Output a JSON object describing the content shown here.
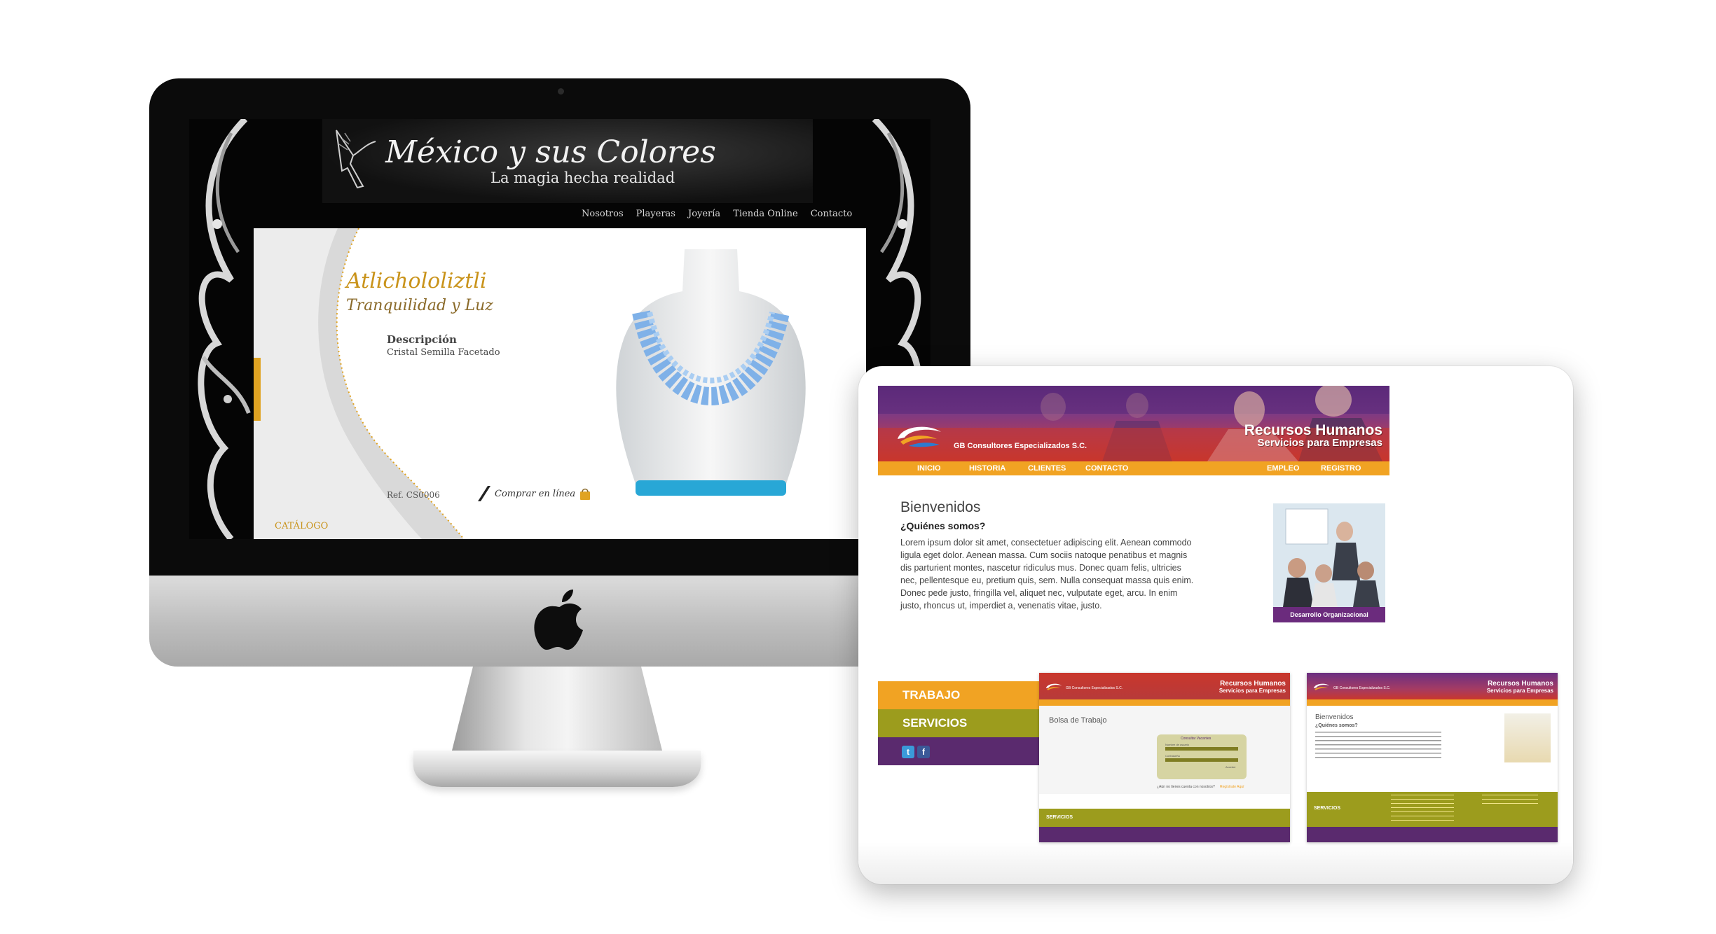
{
  "imac_site": {
    "title": "México y sus Colores",
    "tagline": "La magia hecha realidad",
    "nav": [
      "Nosotros",
      "Playeras",
      "Joyería",
      "Tienda Online",
      "Contacto"
    ],
    "product": {
      "name": "Atlichololiztli",
      "subtitle": "Tranquilidad y Luz",
      "description_label": "Descripción",
      "description": "Cristal Semilla Facetado",
      "ref": "Ref. CS0006",
      "buy_label": "Comprar en línea"
    },
    "catalog_label": "CATÁLOGO"
  },
  "tablet_site": {
    "company": "GB Consultores Especializados S.C.",
    "hero_title": "Recursos Humanos",
    "hero_subtitle": "Servicios para Empresas",
    "nav_left": [
      "INICIO",
      "HISTORIA",
      "CLIENTES",
      "CONTACTO"
    ],
    "nav_right": [
      "EMPLEO",
      "REGISTRO"
    ],
    "welcome": "Bienvenidos",
    "who_heading": "¿Quiénes somos?",
    "body": "Lorem ipsum dolor sit amet, consectetuer adipiscing elit. Aenean commodo ligula eget dolor. Aenean massa. Cum sociis natoque penatibus et magnis dis parturient montes, nascetur ridiculus mus. Donec quam felis, ultricies nec, pellentesque eu, pretium quis, sem. Nulla consequat massa quis enim. Donec pede justo, fringilla vel, aliquet nec, vulputate eget, arcu. In enim justo, rhoncus ut, imperdiet a, venenatis vitae, justo.",
    "photo_caption": "Desarrollo Organizacional",
    "sidebar": [
      "TRABAJO",
      "SERVICIOS"
    ],
    "social": [
      "twitter-icon",
      "facebook-icon"
    ],
    "mini_1": {
      "heading": "Bolsa de Trabajo",
      "form_title": "Consultar Vacantes",
      "field_1": "Nombre de usuario",
      "field_2": "Contraseña",
      "submit": "Acceder",
      "register_prompt": "¿Aún no tienes cuenta con nosotros?",
      "register_link": "Regístrate Aquí",
      "footer": "SERVICIOS"
    },
    "mini_2": {
      "heading": "Bienvenidos",
      "subheading": "¿Quiénes somos?",
      "footer": "SERVICIOS"
    }
  },
  "colors": {
    "gb_orange": "#f1a323",
    "gb_olive": "#9c9c1d",
    "gb_purple": "#5a2a6e",
    "mx_gold": "#c9931a"
  }
}
